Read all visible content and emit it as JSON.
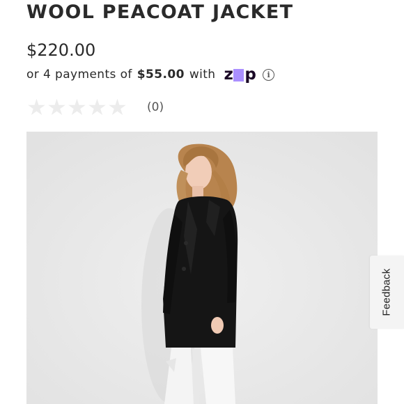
{
  "product": {
    "title": "WOOL PEACOAT JACKET",
    "price": "$220.00"
  },
  "installments": {
    "prefix": "or 4 payments of",
    "amount": "$55.00",
    "suffix": "with",
    "provider_logo": "zip",
    "info_icon": "info-icon",
    "provider_colors": {
      "text": "#1a0826",
      "accent": "#aa8fff"
    }
  },
  "rating": {
    "stars_filled": 0,
    "stars_total": 5,
    "review_count": "(0)"
  },
  "image": {
    "subject": "model wearing black wool peacoat with white jeans",
    "background_color": "#eaeaea"
  },
  "feedback": {
    "label": "Feedback"
  }
}
